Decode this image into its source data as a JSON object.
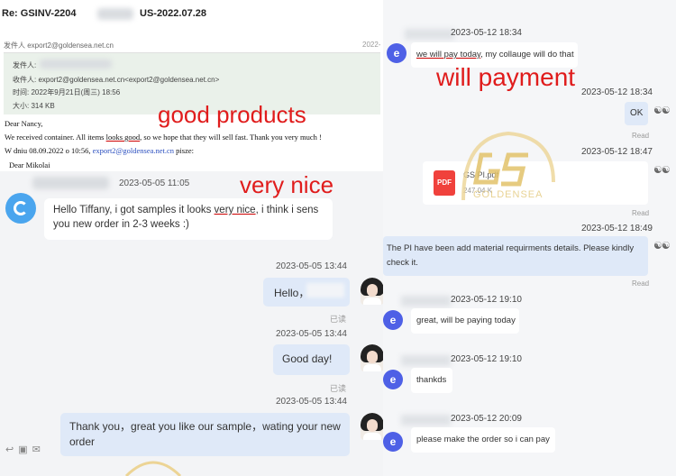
{
  "email": {
    "title_prefix": "Re: GSINV-2204",
    "title_suffix": "US-2022.07.28",
    "reply_line": "发件人 export2@goldensea.net.cn",
    "reply_date": "2022-",
    "from_label": "发件人:",
    "to_line": "收件人: export2@goldensea.net.cn<export2@goldensea.net.cn>",
    "time_line": "时间: 2022年9月21日(周三) 18:56",
    "size_line": "大小: 314 KB",
    "greeting": "Dear Nancy,",
    "line1_a": "We received container. All items ",
    "line1_u": "looks good",
    "line1_b": ", so we hope that they will sell fast. Thank you very much !",
    "line2_a": "W dniu 08.09.2022 o 10:56, ",
    "line2_link": "export2@goldensea.net.cn",
    "line2_b": " pisze:",
    "sign": "Dear Mikolai"
  },
  "annotations": {
    "good": "good products",
    "nice": "very nice",
    "pay": "will payment"
  },
  "left_chat": {
    "msg1_time": "2023-05-05 11:05",
    "msg1_a": "Hello Tiffany, i got samples it looks ",
    "msg1_u": "very nice",
    "msg1_b": ", i think i sens you new order in 2-3 weeks :)",
    "msg2_time": "2023-05-05 13:44",
    "msg2": "Hello，",
    "msg2_read": "已读",
    "msg3_time": "2023-05-05 13:44",
    "msg3": "Good day!",
    "msg3_read": "已读",
    "msg4_time": "2023-05-05 13:44",
    "msg4": "Thank you，great you like our sample，wating your new order"
  },
  "right_chat": {
    "m1_time": "2023-05-12 18:34",
    "m1_u": "we will pay today",
    "m1_b": ", my collauge will do that",
    "m2_time": "2023-05-12 18:34",
    "m2": "OK",
    "m2_read": "Read",
    "m3_time": "2023-05-12 18:47",
    "pdf_icon": "PDF",
    "pdf_name": "GS           PI.pdf",
    "pdf_size": "247.04 K",
    "m3_read": "Read",
    "m4_time": "2023-05-12 18:49",
    "m4": "The PI have been add material requirments details. Please kindly check it.",
    "m4_read": "Read",
    "m5_time": "2023-05-12 19:10",
    "m5": "great, will be paying today",
    "m6_time": "2023-05-12 19:10",
    "m6": "thankds",
    "m7_time": "2023-05-12 20:09",
    "m7": "please make the order so i can pay",
    "avatar_letter": "e"
  },
  "watermark": "GOLDENSEA",
  "colors": {
    "annotation": "#e01c1c",
    "avatar": "#4e60e6",
    "bubble_self": "#dfe9f8"
  }
}
